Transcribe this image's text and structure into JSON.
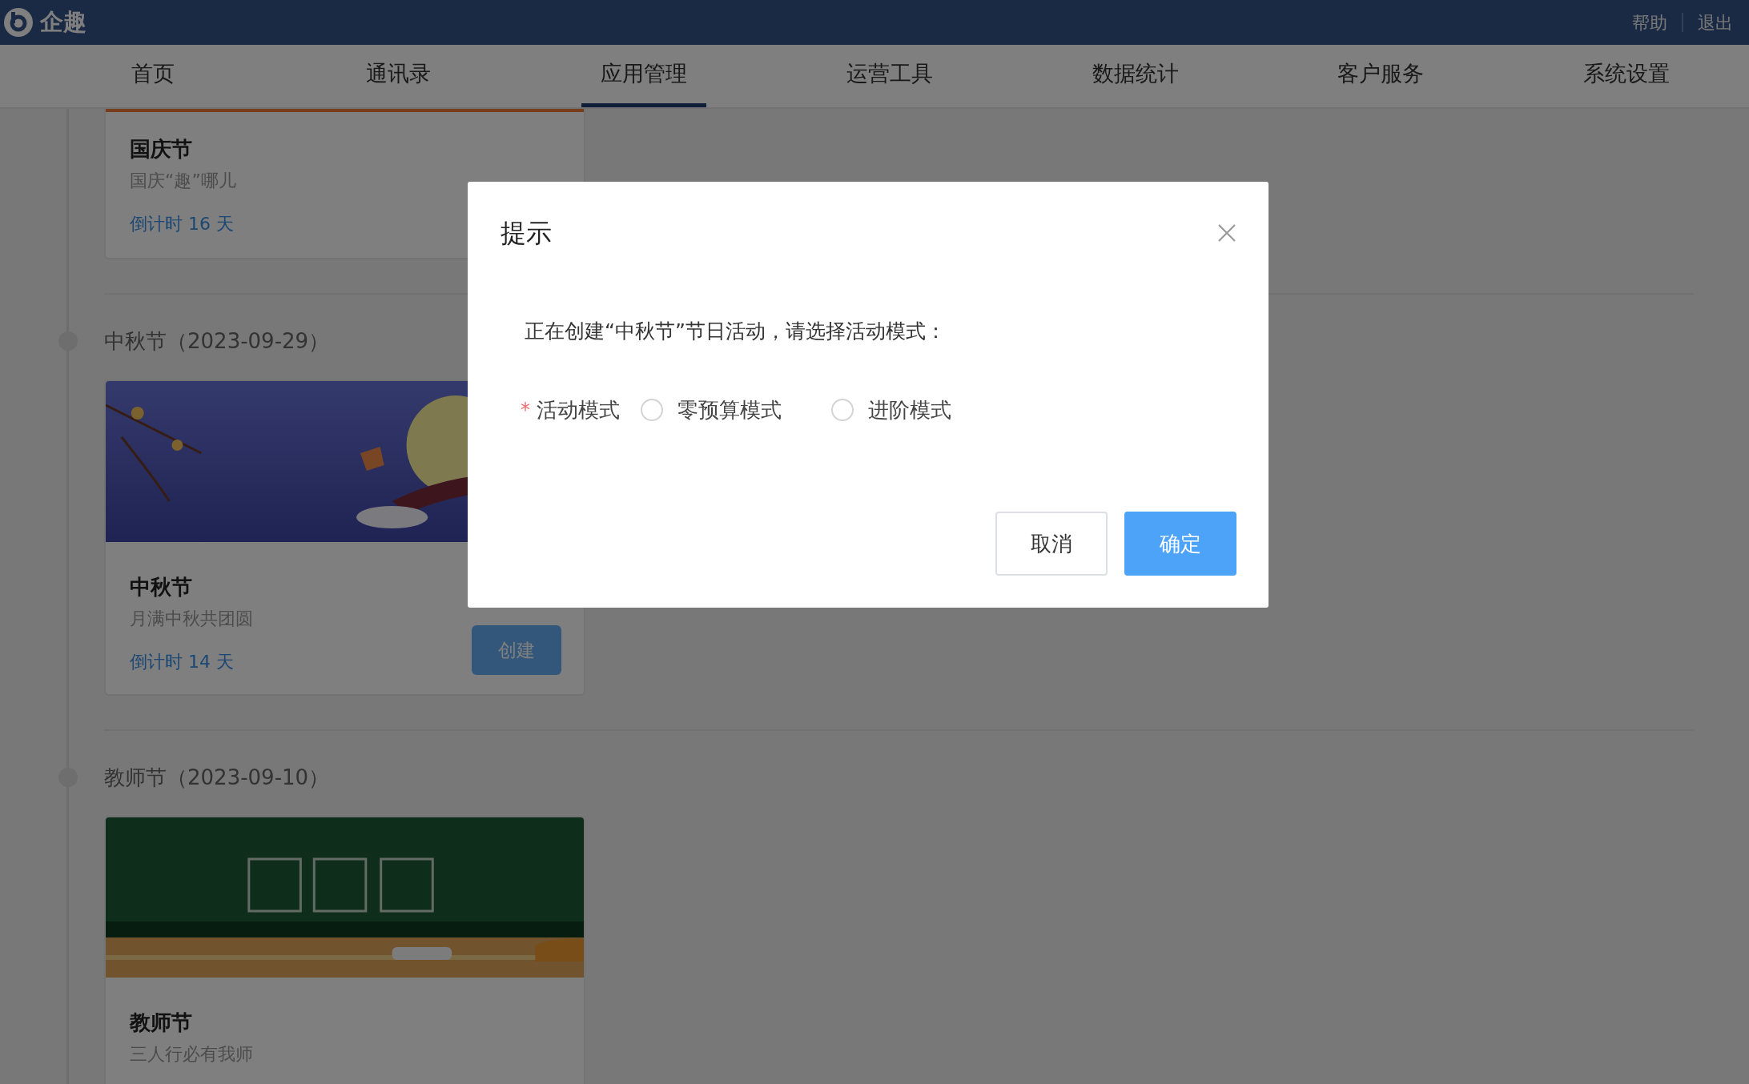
{
  "top_bar": {
    "logo_text": "企趣",
    "links": [
      "帮助",
      "退出"
    ]
  },
  "nav": {
    "tabs": [
      {
        "label": "首页",
        "selected": false
      },
      {
        "label": "通讯录",
        "selected": false
      },
      {
        "label": "应用管理",
        "selected": true
      },
      {
        "label": "运营工具",
        "selected": false
      },
      {
        "label": "数据统计",
        "selected": false
      },
      {
        "label": "客户服务",
        "selected": false
      },
      {
        "label": "系统设置",
        "selected": false
      }
    ]
  },
  "timeline": [
    {
      "kind": "partial",
      "title": "国庆节",
      "subtitle": "国庆“趣”哪儿",
      "countdown": "倒计时 16 天"
    },
    {
      "kind": "full",
      "heading": "中秋节（2023-09-29）",
      "banner": {
        "kind": "moon"
      },
      "title": "中秋节",
      "subtitle": "月满中秋共团圆",
      "countdown": "倒计时 14 天",
      "button": "创建"
    },
    {
      "kind": "full",
      "heading": "教师节（2023-09-10）",
      "banner": {
        "kind": "chalkboard"
      },
      "title": "教师节",
      "subtitle": "三人行必有我师"
    }
  ],
  "dialog": {
    "title": "提示",
    "message": "正在创建“中秋节”节日活动，请选择活动模式：",
    "field": {
      "label": "活动模式",
      "required_mark": "*",
      "options": [
        {
          "label": "零预算模式",
          "selected": false
        },
        {
          "label": "进阶模式",
          "selected": false
        }
      ]
    },
    "buttons": [
      {
        "label": "取消",
        "kind": "default"
      },
      {
        "label": "确定",
        "kind": "primary"
      }
    ]
  }
}
